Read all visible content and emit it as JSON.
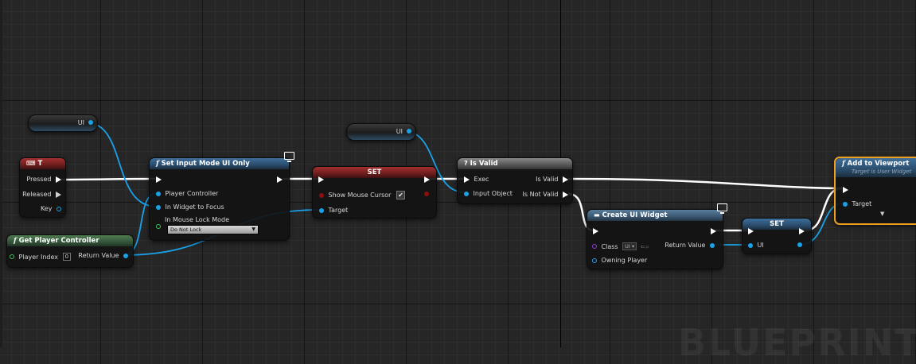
{
  "watermark": "BLUEPRINT",
  "colors": {
    "background": "#262626",
    "exec_wire": "#ffffff",
    "object_wire": "#19a2e8",
    "function_header": "#2a4c6c",
    "pure_function_header": "#33553a",
    "set_header": "#6d1d1d",
    "macro_header": "#565656",
    "selection": "#f0a020"
  },
  "variables": {
    "ui_getter_1": {
      "label": "UI"
    },
    "ui_getter_2": {
      "label": "UI"
    }
  },
  "key_event": {
    "title": "T",
    "icon": "keyboard-icon",
    "pins": {
      "pressed": "Pressed",
      "released": "Released",
      "key": "Key"
    }
  },
  "get_player_controller": {
    "title": "Get Player Controller",
    "player_index_label": "Player Index",
    "player_index_value": "0",
    "return_label": "Return Value"
  },
  "set_input_mode": {
    "title": "Set Input Mode UI Only",
    "player_controller": "Player Controller",
    "in_widget_to_focus": "In Widget to Focus",
    "in_mouse_lock_mode": "In Mouse Lock Mode",
    "mouse_lock_value": "Do Not Lock"
  },
  "set_cursor": {
    "title": "SET",
    "show_mouse_cursor": "Show Mouse Cursor",
    "checkbox": "✔",
    "target": "Target"
  },
  "is_valid": {
    "title": "Is Valid",
    "exec": "Exec",
    "input_object": "Input Object",
    "is_valid": "Is Valid",
    "is_not_valid": "Is Not Valid"
  },
  "create_widget": {
    "title": "Create UI Widget",
    "class_label": "Class",
    "class_value": "UI ▾",
    "return_label": "Return Value",
    "owning_player": "Owning Player"
  },
  "set_ui": {
    "title": "SET",
    "ui_label": "UI"
  },
  "add_to_viewport": {
    "title": "Add to Viewport",
    "subtitle": "Target is User Widget",
    "target": "Target"
  }
}
